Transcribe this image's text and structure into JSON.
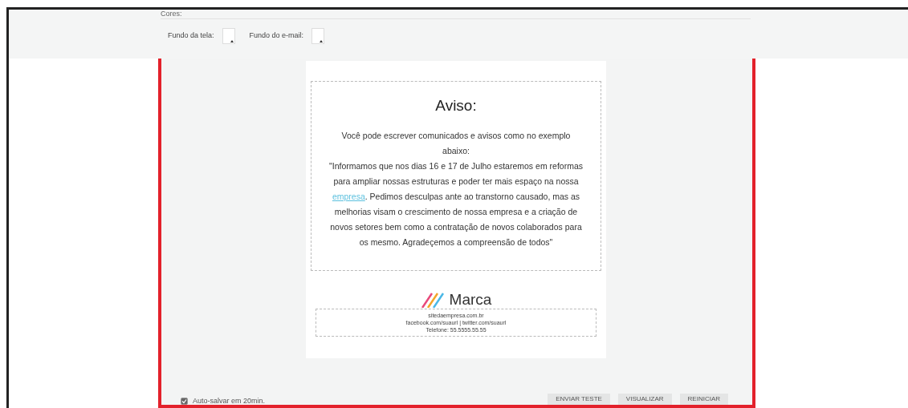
{
  "section_title": "Cores:",
  "colors": [
    {
      "label": "Fundo da tela:"
    },
    {
      "label": "Fundo do e-mail:"
    }
  ],
  "email": {
    "heading": "Aviso:",
    "body": [
      "Você pode escrever comunicados e avisos como no exemplo abaixo:",
      "\"Informamos que nos dias 16 e 17 de Julho estaremos em reformas para ampliar nossas estruturas e poder ter mais espaço na nossa ",
      "empresa",
      ". Pedimos desculpas ante ao transtorno causado, mas as melhorias visam o crescimento de nossa empresa e a criação de novos setores bem como a contratação de novos colaborados para os mesmo. Agradeçemos a compreensão de todos\""
    ],
    "brand": "Marca",
    "footer": [
      "sitedaempresa.com.br",
      "facebook.com/suaurl | twitter.com/suaurl",
      "Telefone: 55.5555.55.55"
    ]
  },
  "autosave": {
    "label": "Auto-salvar em 20min.",
    "checked": true
  },
  "buttons": [
    "ENVIAR TESTE",
    "VISUALIZAR",
    "REINICIAR"
  ]
}
